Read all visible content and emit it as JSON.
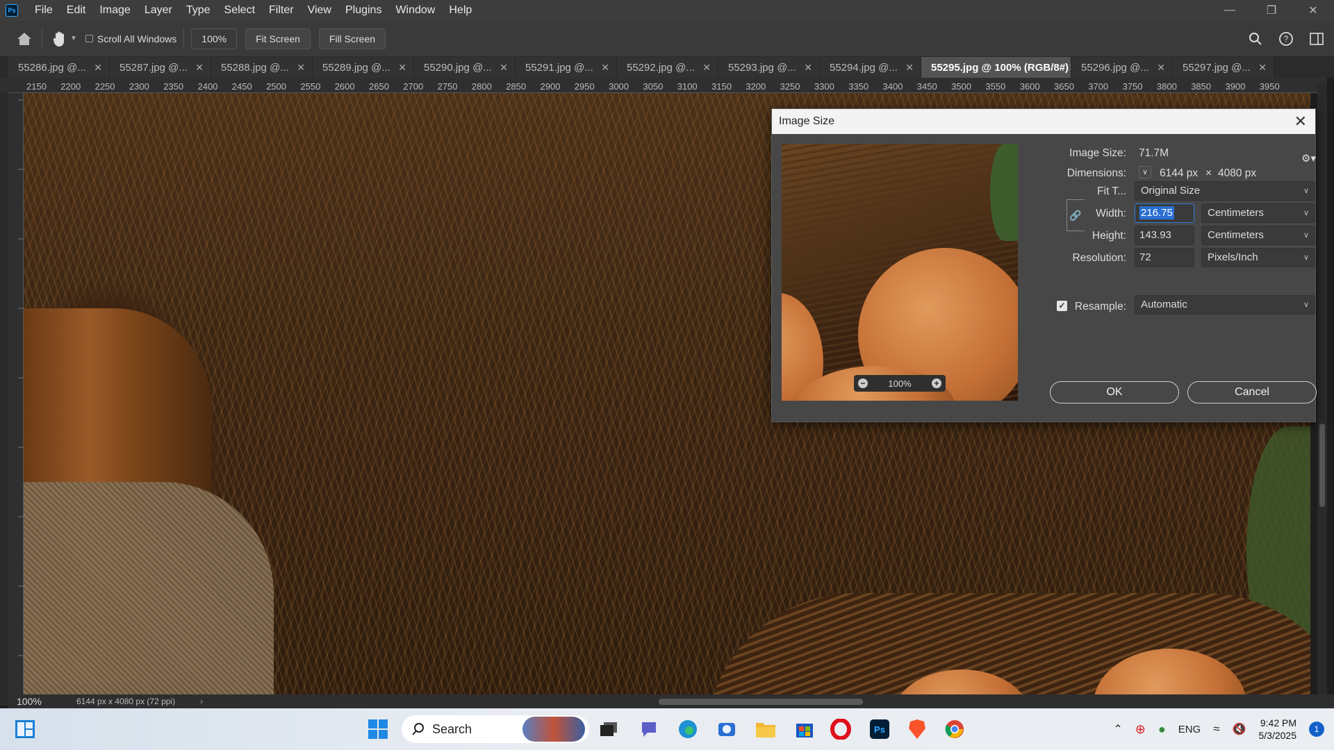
{
  "app": {
    "logo": "Ps"
  },
  "menu": [
    "File",
    "Edit",
    "Image",
    "Layer",
    "Type",
    "Select",
    "Filter",
    "View",
    "Plugins",
    "Window",
    "Help"
  ],
  "options": {
    "scroll_all_windows": "Scroll All Windows",
    "zoom_value": "100%",
    "fit_screen": "Fit Screen",
    "fill_screen": "Fill Screen"
  },
  "tabs": [
    {
      "label": "55286.jpg @...",
      "active": false
    },
    {
      "label": "55287.jpg @...",
      "active": false
    },
    {
      "label": "55288.jpg @...",
      "active": false
    },
    {
      "label": "55289.jpg @...",
      "active": false
    },
    {
      "label": "55290.jpg @...",
      "active": false
    },
    {
      "label": "55291.jpg @...",
      "active": false
    },
    {
      "label": "55292.jpg @...",
      "active": false
    },
    {
      "label": "55293.jpg @...",
      "active": false
    },
    {
      "label": "55294.jpg @...",
      "active": false
    },
    {
      "label": "55295.jpg @ 100% (RGB/8#)",
      "active": true
    },
    {
      "label": "55296.jpg @...",
      "active": false
    },
    {
      "label": "55297.jpg @...",
      "active": false
    }
  ],
  "ruler_ticks": [
    "2150",
    "2200",
    "2250",
    "2300",
    "2350",
    "2400",
    "2450",
    "2500",
    "2550",
    "2600",
    "2650",
    "2700",
    "2750",
    "2800",
    "2850",
    "2900",
    "2950",
    "3000",
    "3050",
    "3100",
    "3150",
    "3200",
    "3250",
    "3300",
    "3350",
    "3400",
    "3450",
    "3500",
    "3550",
    "3600",
    "3650",
    "3700",
    "3750",
    "3800",
    "3850",
    "3900",
    "3950"
  ],
  "status": {
    "zoom": "100%",
    "doc_info": "6144 px x 4080 px (72 ppi)"
  },
  "dialog": {
    "title": "Image Size",
    "image_size_label": "Image Size:",
    "image_size_value": "71.7M",
    "dimensions_label": "Dimensions:",
    "dim_width": "6144 px",
    "dim_sep": "×",
    "dim_height": "4080 px",
    "fit_label": "Fit T...",
    "fit_value": "Original Size",
    "width_label": "Width:",
    "width_value": "216.75",
    "width_unit": "Centimeters",
    "height_label": "Height:",
    "height_value": "143.93",
    "height_unit": "Centimeters",
    "resolution_label": "Resolution:",
    "resolution_value": "72",
    "resolution_unit": "Pixels/Inch",
    "resample_label": "Resample:",
    "resample_checked": true,
    "resample_value": "Automatic",
    "preview_zoom": "100%",
    "ok": "OK",
    "cancel": "Cancel"
  },
  "taskbar": {
    "search_placeholder": "Search",
    "lang": "ENG",
    "time": "9:42 PM",
    "date": "5/3/2025",
    "notifications": "1"
  }
}
